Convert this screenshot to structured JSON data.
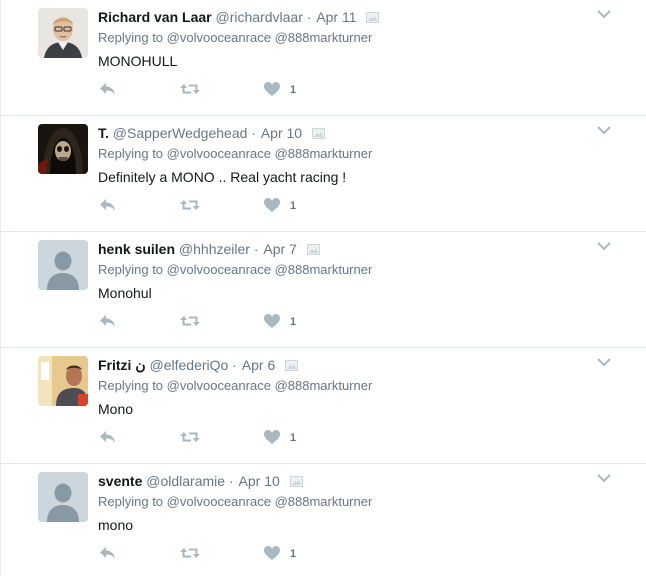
{
  "tweets": [
    {
      "name": "Richard van Laar",
      "handle": "@richardvlaar",
      "separator": "·",
      "time": "Apr 11",
      "replying_prefix": "Replying to",
      "reply_to_1": "@volvooceanrace",
      "reply_to_2": "@888markturner",
      "text": "MONOHULL",
      "likes": "1",
      "avatar_icon": "photo-man-glasses"
    },
    {
      "name": "T.",
      "handle": "@SapperWedgehead",
      "separator": "·",
      "time": "Apr 10",
      "replying_prefix": "Replying to",
      "reply_to_1": "@volvooceanrace",
      "reply_to_2": "@888markturner",
      "text": "Definitely a MONO .. Real yacht racing !",
      "likes": "1",
      "avatar_icon": "photo-skull-hood"
    },
    {
      "name": "henk suilen",
      "handle": "@hhhzeiler",
      "separator": "·",
      "time": "Apr 7",
      "replying_prefix": "Replying to",
      "reply_to_1": "@volvooceanrace",
      "reply_to_2": "@888markturner",
      "text": "Monohul",
      "likes": "1",
      "avatar_icon": "default-egg"
    },
    {
      "name": "Fritzi ن",
      "handle": "@elfederiQo",
      "separator": "·",
      "time": "Apr 6",
      "replying_prefix": "Replying to",
      "reply_to_1": "@volvooceanrace",
      "reply_to_2": "@888markturner",
      "text": "Mono",
      "likes": "1",
      "avatar_icon": "photo-man-shop"
    },
    {
      "name": "svente",
      "handle": "@oldlaramie",
      "separator": "·",
      "time": "Apr 10",
      "replying_prefix": "Replying to",
      "reply_to_1": "@volvooceanrace",
      "reply_to_2": "@888markturner",
      "text": "mono",
      "likes": "1",
      "avatar_icon": "default-egg"
    }
  ],
  "colors": {
    "name": "#14171a",
    "muted": "#657786",
    "icon": "#aab8c2",
    "divider": "#e1e8ed",
    "default_avatar_bg": "#ccd6dd",
    "default_avatar_fg": "#8899a6"
  }
}
